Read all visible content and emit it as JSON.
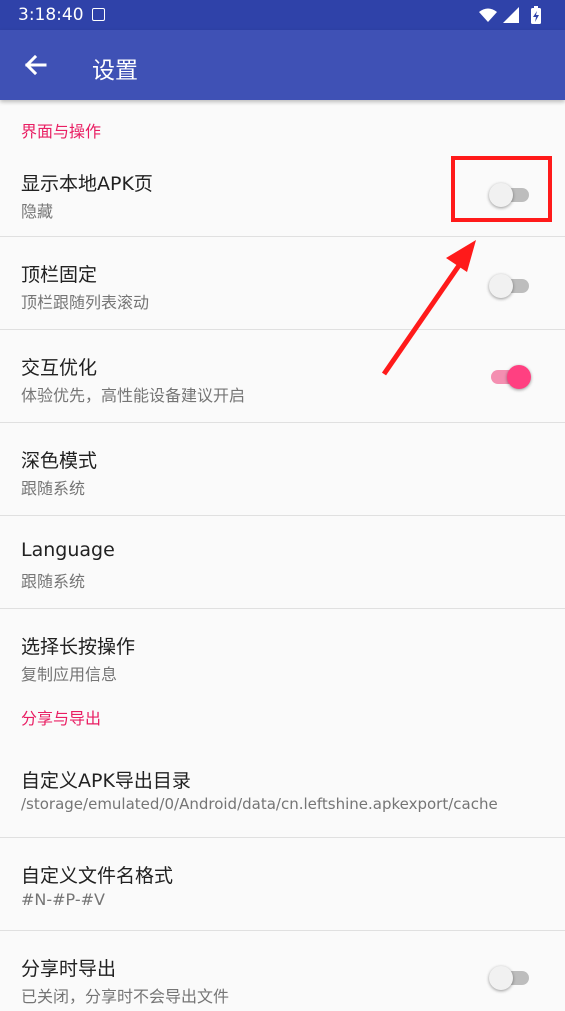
{
  "status_bar": {
    "time": "3:18:40",
    "icons": [
      "notification-icon",
      "wifi-icon",
      "signal-icon",
      "battery-charging-icon"
    ]
  },
  "toolbar": {
    "back_icon": "arrow-left-icon",
    "title": "设置"
  },
  "sections": [
    {
      "header": "界面与操作"
    },
    {
      "header": "分享与导出"
    }
  ],
  "settings": [
    {
      "title": "显示本地APK页",
      "subtitle": "隐藏",
      "toggle": "off"
    },
    {
      "title": "顶栏固定",
      "subtitle": "顶栏跟随列表滚动",
      "toggle": "off"
    },
    {
      "title": "交互优化",
      "subtitle": "体验优先，高性能设备建议开启",
      "toggle": "on"
    },
    {
      "title": "深色模式",
      "subtitle": "跟随系统"
    },
    {
      "title": "Language",
      "subtitle": "跟随系统"
    },
    {
      "title": "选择长按操作",
      "subtitle": "复制应用信息"
    },
    {
      "title": "自定义APK导出目录",
      "subtitle": "/storage/emulated/0/Android/data/cn.leftshine.apkexport/cache"
    },
    {
      "title": "自定义文件名格式",
      "subtitle": "#N-#P-#V"
    },
    {
      "title": "分享时导出",
      "subtitle": "已关闭，分享时不会导出文件",
      "toggle": "off"
    }
  ],
  "colors": {
    "status_bar": "#2f42a9",
    "toolbar": "#3f51b5",
    "section_header": "#e91e63",
    "switch_on": "#ff4081",
    "annotation": "#ff1a1a"
  }
}
